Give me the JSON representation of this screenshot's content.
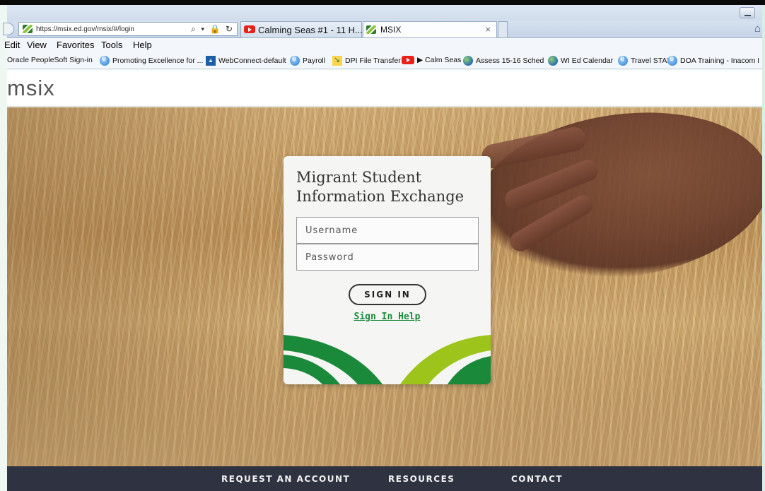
{
  "browser": {
    "address_url": "https://msix.ed.gov/msix/#/login",
    "address_icons": "⌕ ▾ 🔒 ↻",
    "tabs": [
      {
        "label": "Calming Seas #1 - 11 H...",
        "icon": "youtube-icon"
      },
      {
        "label": "MSIX",
        "icon": "msix-favicon",
        "close": "×"
      }
    ],
    "menu": [
      "Edit",
      "View",
      "Favorites",
      "Tools",
      "Help"
    ],
    "favorites": [
      {
        "label": "Oracle PeopleSoft Sign-in",
        "icon": "none"
      },
      {
        "label": "Promoting Excellence for ...",
        "icon": "ie-icon"
      },
      {
        "label": "WebConnect-default",
        "icon": "kiosk-icon"
      },
      {
        "label": "Payroll",
        "icon": "ie-icon"
      },
      {
        "label": "DPI File Transfer",
        "icon": "dpi-icon"
      },
      {
        "label": "▶ Calm Seas",
        "icon": "youtube-icon"
      },
      {
        "label": "Assess 15-16 Sched",
        "icon": "globe-icon"
      },
      {
        "label": "WI Ed Calendar",
        "icon": "globe-icon"
      },
      {
        "label": "Travel STAR",
        "icon": "ie-icon"
      },
      {
        "label": "DOA Training - Inacom I",
        "icon": "ie-icon"
      }
    ]
  },
  "site": {
    "logo": "msix"
  },
  "login": {
    "title": "Migrant Student Information Exchange",
    "username_placeholder": "Username",
    "password_placeholder": "Password",
    "signin_label": "SIGN IN",
    "help_label": "Sign In Help",
    "colors": {
      "dark_green": "#1a8a3a",
      "lime": "#9dc41a",
      "link": "#1c8a3b"
    }
  },
  "footer": {
    "links": [
      "REQUEST AN ACCOUNT",
      "RESOURCES",
      "CONTACT"
    ]
  }
}
